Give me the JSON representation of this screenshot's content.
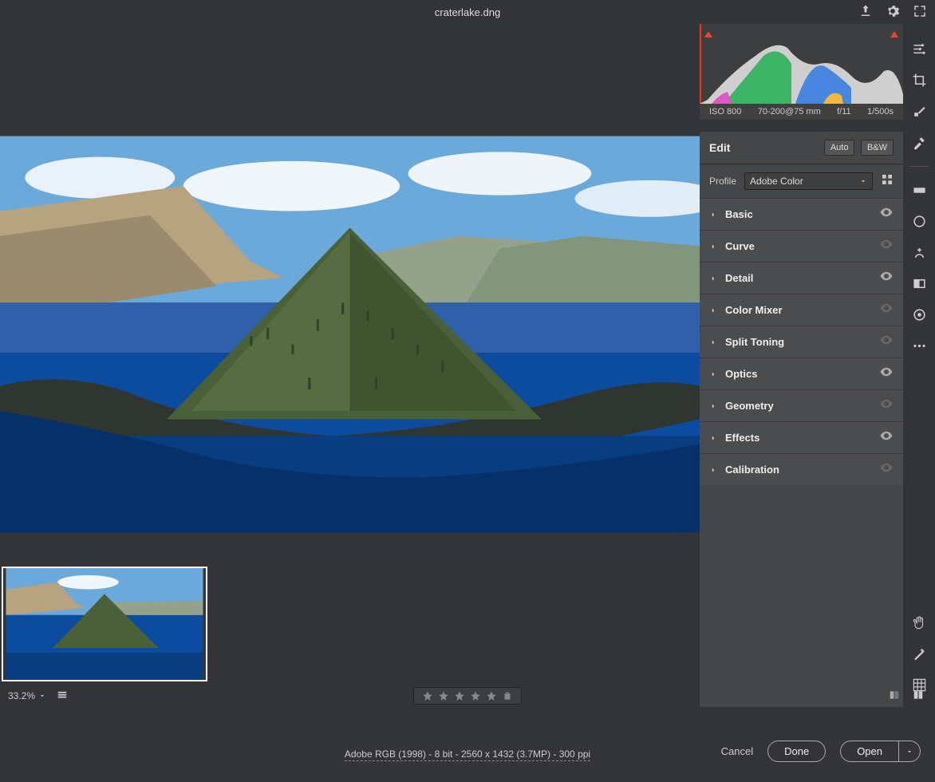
{
  "header": {
    "filename": "craterlake.dng"
  },
  "metadata": {
    "iso": "ISO 800",
    "lens": "70-200@75 mm",
    "aperture": "f/11",
    "shutter": "1/500s"
  },
  "edit_panel": {
    "title": "Edit",
    "auto": "Auto",
    "bw": "B&W",
    "profile_label": "Profile",
    "profile_value": "Adobe Color"
  },
  "accordion": [
    {
      "label": "Basic",
      "eye_active": true
    },
    {
      "label": "Curve",
      "eye_active": false
    },
    {
      "label": "Detail",
      "eye_active": true
    },
    {
      "label": "Color Mixer",
      "eye_active": false
    },
    {
      "label": "Split Toning",
      "eye_active": false
    },
    {
      "label": "Optics",
      "eye_active": true
    },
    {
      "label": "Geometry",
      "eye_active": false
    },
    {
      "label": "Effects",
      "eye_active": true
    },
    {
      "label": "Calibration",
      "eye_active": false
    }
  ],
  "status": {
    "zoom": "33.2%"
  },
  "footer": {
    "info": "Adobe RGB (1998) - 8 bit - 2560 x 1432 (3.7MP) - 300 ppi",
    "cancel": "Cancel",
    "done": "Done",
    "open": "Open"
  }
}
